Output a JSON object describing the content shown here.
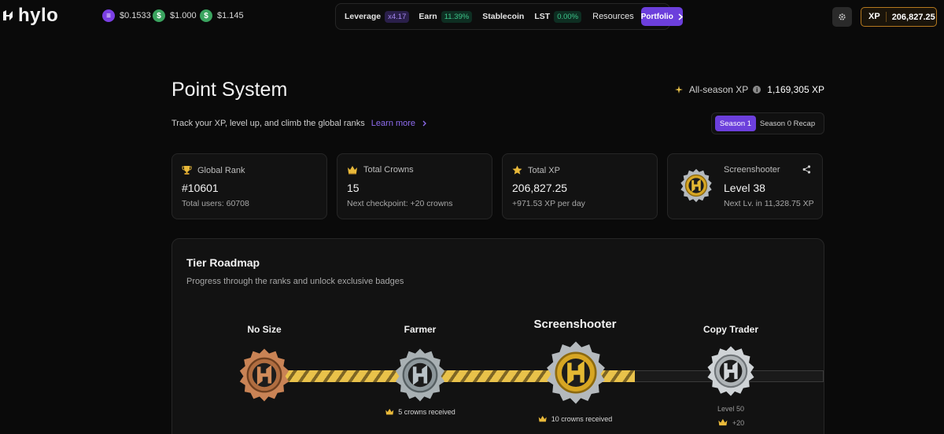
{
  "brand": {
    "logo_text": "hylo"
  },
  "tickers": [
    {
      "icon": "hyusd-coin-icon",
      "value": "$0.1533"
    },
    {
      "icon": "stablecoin-icon",
      "value": "$1.000"
    },
    {
      "icon": "shyusd-coin-icon",
      "value": "$1.145"
    }
  ],
  "nav": {
    "leverage": {
      "label": "Leverage",
      "badge": "x4.17"
    },
    "earn": {
      "label": "Earn",
      "badge": "11.39%"
    },
    "stablecoin": {
      "label": "Stablecoin"
    },
    "lst": {
      "label": "LST",
      "badge": "0.00%"
    },
    "resources": {
      "label": "Resources"
    },
    "portfolio": {
      "label": "Portfolio"
    }
  },
  "xp_pill": {
    "label": "XP",
    "value": "206,827.25"
  },
  "header": {
    "title": "Point System",
    "subtitle": "Track your XP, level up, and climb the global ranks",
    "learn_more": "Learn more",
    "all_season_label": "All-season XP",
    "all_season_value": "1,169,305 XP"
  },
  "season_toggle": {
    "active": "Season 1",
    "inactive": "Season 0 Recap"
  },
  "cards": {
    "global_rank": {
      "label": "Global Rank",
      "value": "#10601",
      "sub": "Total users: 60708"
    },
    "total_crowns": {
      "label": "Total Crowns",
      "value": "15",
      "sub": "Next checkpoint: +20 crowns"
    },
    "total_xp": {
      "label": "Total XP",
      "value": "206,827.25",
      "sub": "+971.53 XP per day"
    },
    "level": {
      "label": "Screenshooter",
      "value": "Level 38",
      "sub": "Next Lv. in 11,328.75 XP"
    }
  },
  "roadmap": {
    "title": "Tier Roadmap",
    "subtitle": "Progress through the ranks and unlock exclusive badges",
    "tiers": [
      {
        "name": "No Size",
        "note": ""
      },
      {
        "name": "Farmer",
        "note": "5 crowns received"
      },
      {
        "name": "Screenshooter",
        "note": "10 crowns received"
      },
      {
        "name": "Copy Trader",
        "level": "Level 50",
        "reward": "+20"
      }
    ]
  },
  "colors": {
    "accent": "#6c3fdc",
    "gold": "#e9c24a",
    "bronze": "#c98355",
    "silver": "#b9c2c7",
    "xp_border": "#b5791f"
  }
}
